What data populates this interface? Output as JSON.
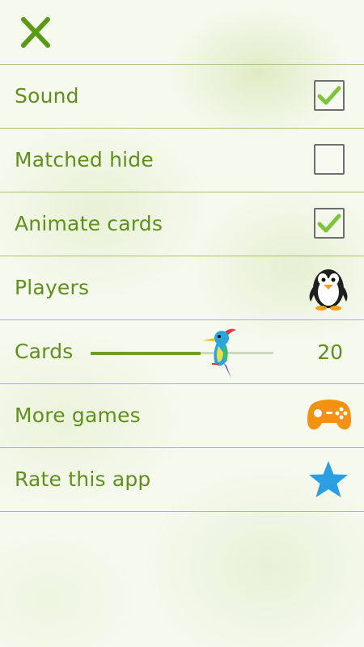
{
  "settings": {
    "sound": {
      "label": "Sound",
      "checked": true
    },
    "matched_hide": {
      "label": "Matched hide",
      "checked": false
    },
    "animate_cards": {
      "label": "Animate cards",
      "checked": true
    },
    "players": {
      "label": "Players",
      "icon": "penguin-icon"
    },
    "cards": {
      "label": "Cards",
      "value": "20",
      "slider_fraction": 0.6
    },
    "more_games": {
      "label": "More games",
      "icon": "gamepad-icon"
    },
    "rate_app": {
      "label": "Rate this app",
      "icon": "star-icon"
    }
  },
  "colors": {
    "label": "#5f8f1d",
    "divider": "#a9c27a",
    "check": "#7cc43b",
    "close": "#5a9a12",
    "gamepad": "#f4920f",
    "star": "#2c9fe3"
  },
  "header": {
    "close_icon": "close-icon"
  }
}
